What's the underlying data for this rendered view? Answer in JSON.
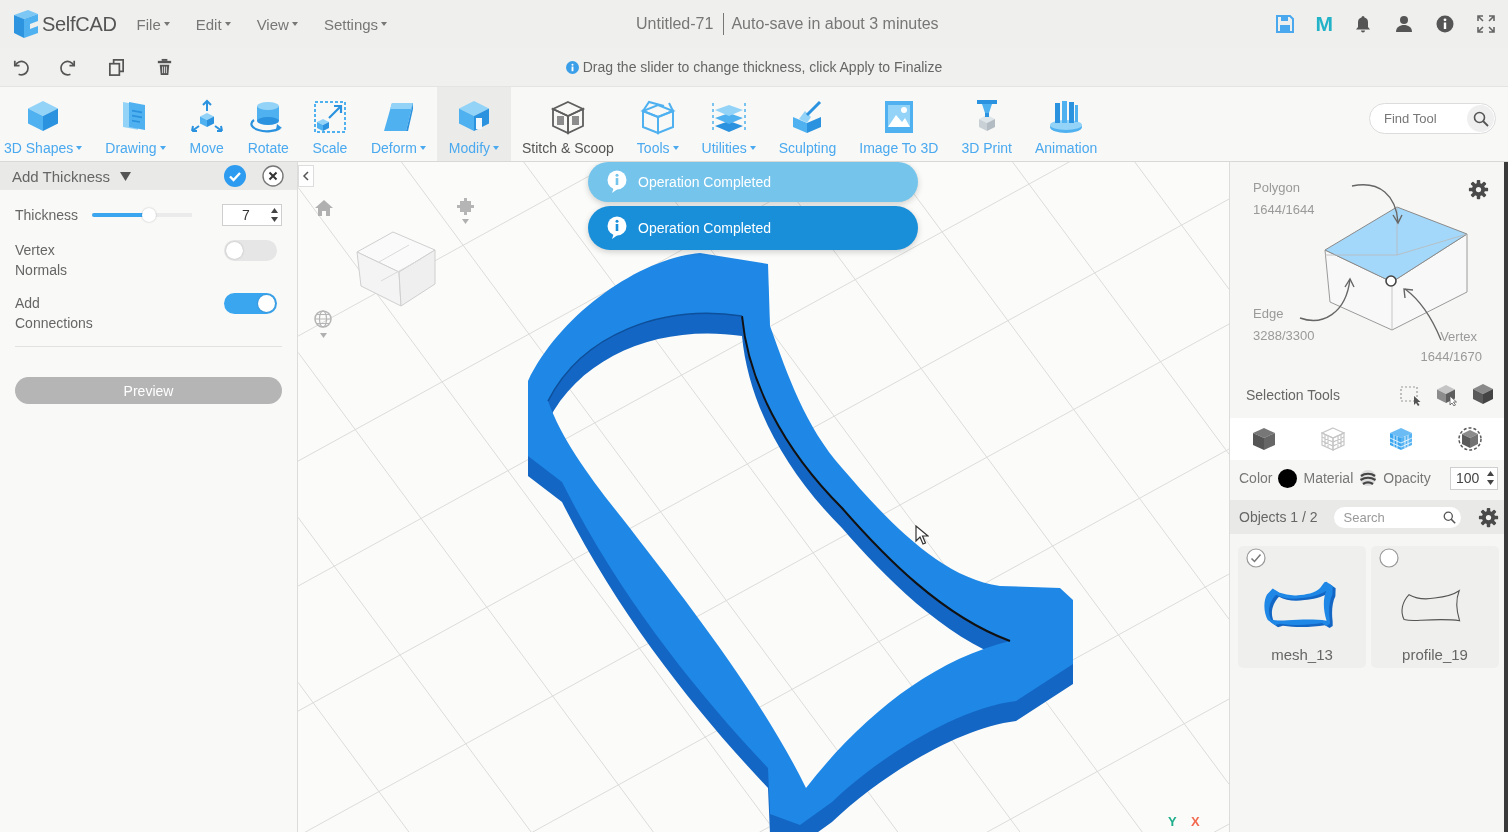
{
  "header": {
    "logo_text": "SelfCAD",
    "menus": [
      {
        "label": "File"
      },
      {
        "label": "Edit"
      },
      {
        "label": "View"
      },
      {
        "label": "Settings"
      }
    ],
    "document_title": "Untitled-71",
    "autosave_status": "Auto-save in about 3 minutes",
    "badge_letter": "M"
  },
  "hint": "Drag the slider to change thickness, click Apply to Finalize",
  "toolbar": {
    "tools": [
      {
        "label": "3D Shapes",
        "dropdown": true,
        "selected": false,
        "kind": "accent"
      },
      {
        "label": "Drawing",
        "dropdown": true,
        "selected": false,
        "kind": "accent"
      },
      {
        "label": "Move",
        "dropdown": false,
        "selected": false,
        "kind": "accent"
      },
      {
        "label": "Rotate",
        "dropdown": false,
        "selected": false,
        "kind": "accent"
      },
      {
        "label": "Scale",
        "dropdown": false,
        "selected": false,
        "kind": "accent"
      },
      {
        "label": "Deform",
        "dropdown": true,
        "selected": false,
        "kind": "accent"
      },
      {
        "label": "Modify",
        "dropdown": true,
        "selected": true,
        "kind": "accent"
      },
      {
        "label": "Stitch & Scoop",
        "dropdown": false,
        "selected": false,
        "kind": "neutral"
      },
      {
        "label": "Tools",
        "dropdown": true,
        "selected": false,
        "kind": "accent"
      },
      {
        "label": "Utilities",
        "dropdown": true,
        "selected": false,
        "kind": "accent"
      },
      {
        "label": "Sculpting",
        "dropdown": false,
        "selected": false,
        "kind": "accent"
      },
      {
        "label": "Image To 3D",
        "dropdown": false,
        "selected": false,
        "kind": "accent"
      },
      {
        "label": "3D Print",
        "dropdown": false,
        "selected": false,
        "kind": "accent"
      },
      {
        "label": "Animation",
        "dropdown": false,
        "selected": false,
        "kind": "accent"
      }
    ],
    "search": {
      "placeholder": "Find Tool"
    }
  },
  "tool_panel": {
    "title": "Add Thickness",
    "thickness": {
      "label": "Thickness",
      "level": 0.57,
      "value": "7"
    },
    "toggles": [
      {
        "label": "Vertex Normals",
        "on": false
      },
      {
        "label": "Add Connections",
        "on": true
      }
    ],
    "preview_button": "Preview"
  },
  "viewport": {
    "toasts": [
      {
        "text": "Operation Completed",
        "fading": true
      },
      {
        "text": "Operation Completed",
        "fading": false
      }
    ],
    "axes": [
      {
        "label": "Y",
        "color": "#1fae8c"
      },
      {
        "label": "X",
        "color": "#f26b50"
      }
    ]
  },
  "selection_info": {
    "polygon": {
      "label": "Polygon",
      "count": "1644/1644"
    },
    "edge": {
      "label": "Edge",
      "count": "3288/3300"
    },
    "vertex": {
      "label": "Vertex",
      "count": "1644/1670"
    },
    "selection_tools": "Selection Tools"
  },
  "display_modes": [
    {
      "selected": false
    },
    {
      "selected": false
    },
    {
      "selected": true
    },
    {
      "selected": false
    }
  ],
  "appearance": {
    "color_label": "Color",
    "color": "#000000",
    "material_label": "Material",
    "opacity_label": "Opacity",
    "opacity": "100"
  },
  "objects": {
    "title": "Objects 1 / 2",
    "search_placeholder": "Search",
    "items": [
      {
        "name": "mesh_13",
        "checked": true
      },
      {
        "name": "profile_19",
        "checked": false
      }
    ]
  }
}
